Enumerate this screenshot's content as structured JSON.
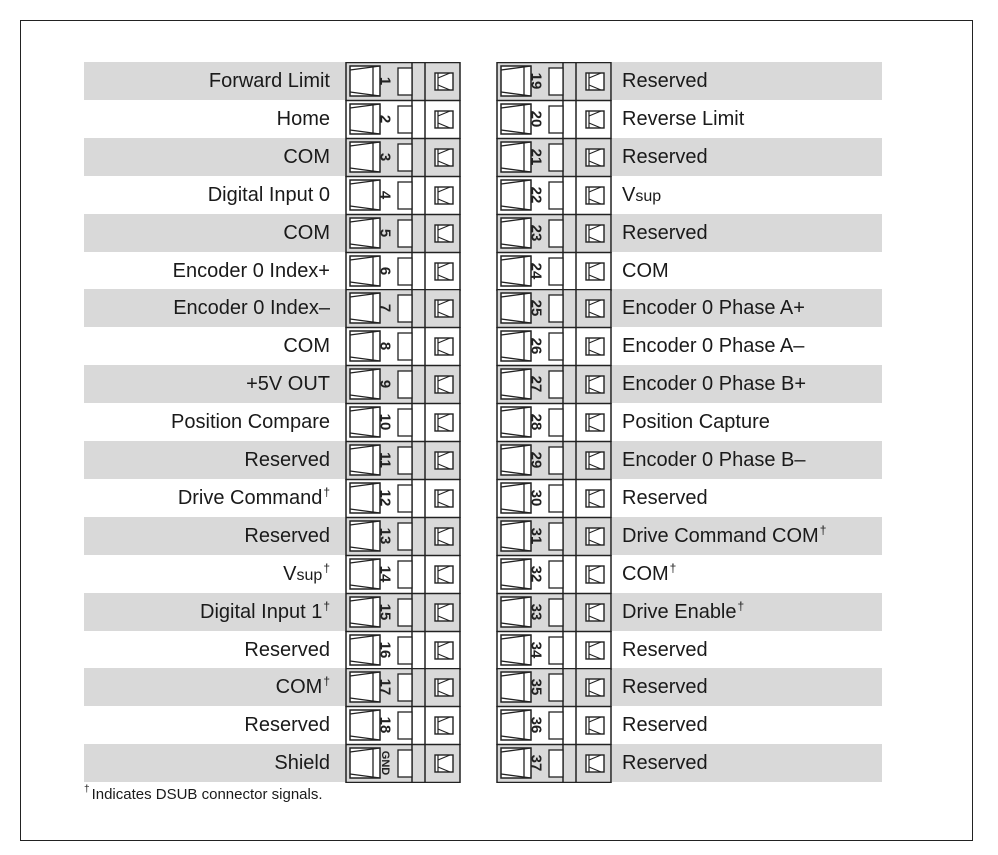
{
  "left_pins": [
    {
      "pin": "1",
      "label": "Forward Limit",
      "dagger": false
    },
    {
      "pin": "2",
      "label": "Home",
      "dagger": false
    },
    {
      "pin": "3",
      "label": "COM",
      "dagger": false
    },
    {
      "pin": "4",
      "label": "Digital Input 0",
      "dagger": false
    },
    {
      "pin": "5",
      "label": "COM",
      "dagger": false
    },
    {
      "pin": "6",
      "label": "Encoder 0 Index+",
      "dagger": false
    },
    {
      "pin": "7",
      "label": "Encoder 0 Index–",
      "dagger": false
    },
    {
      "pin": "8",
      "label": "COM",
      "dagger": false
    },
    {
      "pin": "9",
      "label": "+5V OUT",
      "dagger": false
    },
    {
      "pin": "10",
      "label": "Position Compare",
      "dagger": false
    },
    {
      "pin": "11",
      "label": "Reserved",
      "dagger": false
    },
    {
      "pin": "12",
      "label": "Drive Command",
      "dagger": true
    },
    {
      "pin": "13",
      "label": "Reserved",
      "dagger": false
    },
    {
      "pin": "14",
      "label": "Vsup",
      "dagger": true,
      "small_suffix": true
    },
    {
      "pin": "15",
      "label": "Digital Input 1",
      "dagger": true
    },
    {
      "pin": "16",
      "label": "Reserved",
      "dagger": false
    },
    {
      "pin": "17",
      "label": "COM",
      "dagger": true
    },
    {
      "pin": "18",
      "label": "Reserved",
      "dagger": false
    },
    {
      "pin": "GND",
      "label": "Shield",
      "dagger": false
    }
  ],
  "right_pins": [
    {
      "pin": "19",
      "label": "Reserved",
      "dagger": false
    },
    {
      "pin": "20",
      "label": "Reverse Limit",
      "dagger": false
    },
    {
      "pin": "21",
      "label": "Reserved",
      "dagger": false
    },
    {
      "pin": "22",
      "label": "Vsup",
      "dagger": false,
      "small_suffix": true
    },
    {
      "pin": "23",
      "label": "Reserved",
      "dagger": false
    },
    {
      "pin": "24",
      "label": "COM",
      "dagger": false
    },
    {
      "pin": "25",
      "label": "Encoder 0 Phase A+",
      "dagger": false
    },
    {
      "pin": "26",
      "label": "Encoder 0 Phase A–",
      "dagger": false
    },
    {
      "pin": "27",
      "label": "Encoder 0 Phase B+",
      "dagger": false
    },
    {
      "pin": "28",
      "label": "Position Capture",
      "dagger": false
    },
    {
      "pin": "29",
      "label": "Encoder 0 Phase B–",
      "dagger": false
    },
    {
      "pin": "30",
      "label": "Reserved",
      "dagger": false
    },
    {
      "pin": "31",
      "label": "Drive Command COM",
      "dagger": true
    },
    {
      "pin": "32",
      "label": "COM",
      "dagger": true
    },
    {
      "pin": "33",
      "label": "Drive Enable",
      "dagger": true
    },
    {
      "pin": "34",
      "label": "Reserved",
      "dagger": false
    },
    {
      "pin": "35",
      "label": "Reserved",
      "dagger": false
    },
    {
      "pin": "36",
      "label": "Reserved",
      "dagger": false
    },
    {
      "pin": "37",
      "label": "Reserved",
      "dagger": false
    }
  ],
  "dagger_symbol": "†",
  "footnote": "Indicates DSUB connector signals.",
  "colors": {
    "stripe": "#d9d9d9",
    "line": "#222222"
  }
}
